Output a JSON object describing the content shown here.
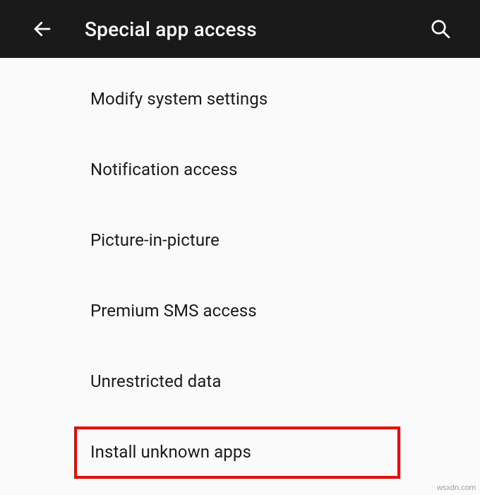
{
  "header": {
    "title": "Special app access"
  },
  "list": {
    "items": [
      {
        "label": "Modify system settings",
        "highlighted": false
      },
      {
        "label": "Notification access",
        "highlighted": false
      },
      {
        "label": "Picture-in-picture",
        "highlighted": false
      },
      {
        "label": "Premium SMS access",
        "highlighted": false
      },
      {
        "label": "Unrestricted data",
        "highlighted": false
      },
      {
        "label": "Install unknown apps",
        "highlighted": true
      }
    ]
  },
  "watermark": "wsxdn.com"
}
